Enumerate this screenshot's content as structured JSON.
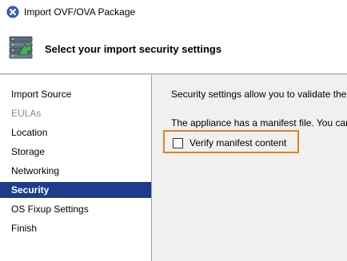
{
  "window": {
    "title": "Import OVF/OVA Package",
    "app_icon": "close-circle-icon"
  },
  "header": {
    "title": "Select your import security settings",
    "icon": "import-package-icon"
  },
  "nav": {
    "items": [
      {
        "label": "Import Source",
        "state": "normal"
      },
      {
        "label": "EULAs",
        "state": "disabled"
      },
      {
        "label": "Location",
        "state": "normal"
      },
      {
        "label": "Storage",
        "state": "normal"
      },
      {
        "label": "Networking",
        "state": "normal"
      },
      {
        "label": "Security",
        "state": "selected"
      },
      {
        "label": "OS Fixup Settings",
        "state": "normal"
      },
      {
        "label": "Finish",
        "state": "normal"
      }
    ]
  },
  "content": {
    "description": "Security settings allow you to validate the",
    "manifest_text": "The appliance has a manifest file. You can",
    "verify_checkbox": {
      "label": "Verify manifest content",
      "checked": false
    }
  },
  "colors": {
    "selected_bg": "#1e3c8c",
    "highlight": "#e8811c",
    "content_bg": "#f0f0f0"
  }
}
